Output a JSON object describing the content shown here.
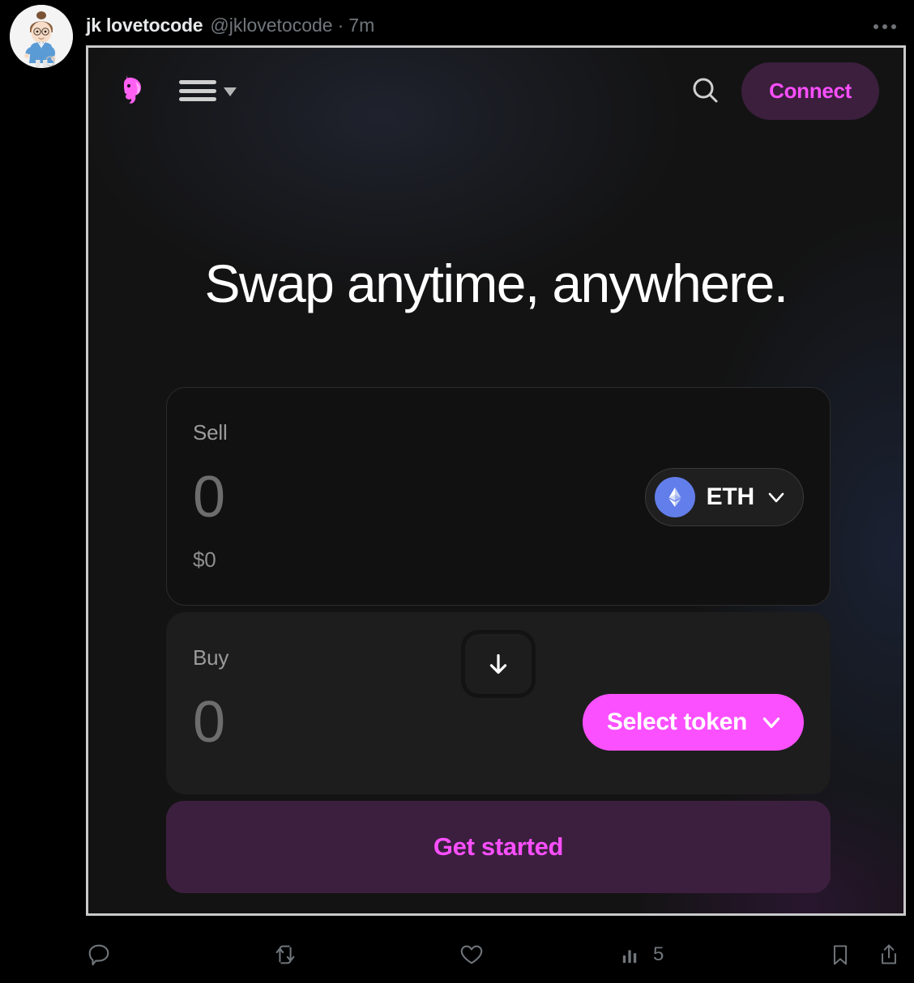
{
  "tweet": {
    "display_name": "jk lovetocode",
    "handle": "@jklovetocode",
    "separator": "·",
    "timestamp": "7m",
    "avatar_name": "avatar",
    "more_label": "more-options"
  },
  "actions": {
    "reply": {
      "icon": "reply-icon",
      "count": ""
    },
    "retweet": {
      "icon": "retweet-icon",
      "count": ""
    },
    "like": {
      "icon": "like-icon",
      "count": ""
    },
    "views": {
      "icon": "views-icon",
      "count": "5"
    },
    "bookmark": {
      "icon": "bookmark-icon"
    },
    "share": {
      "icon": "share-icon"
    }
  },
  "app": {
    "nav": {
      "logo": "uniswap-unicorn-logo",
      "menu": "hamburger-menu",
      "menu_caret": "chevron-down-icon",
      "search": "search-icon",
      "connect_label": "Connect"
    },
    "headline": "Swap anytime, anywhere.",
    "swap": {
      "sell": {
        "label": "Sell",
        "amount": "0",
        "fiat": "$0",
        "token_symbol": "ETH",
        "token_logo": "ethereum-logo"
      },
      "switch_icon": "arrow-down-icon",
      "buy": {
        "label": "Buy",
        "amount": "0",
        "select_token_label": "Select token"
      },
      "cta_label": "Get started"
    }
  },
  "colors": {
    "accent_pink": "#fb50ff",
    "connect_bg": "#3b1f3d",
    "cta_bg": "#3c1f3e",
    "eth_blue": "#627eea",
    "page_bg": "#000000",
    "app_bg": "#131313"
  }
}
